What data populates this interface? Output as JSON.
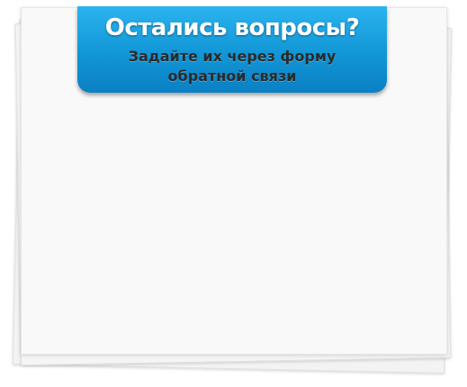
{
  "banner": {
    "title": "Остались вопросы?",
    "subtitle_line1": "Задайте их через форму",
    "subtitle_line2": "обратной связи"
  },
  "colors": {
    "banner_top": "#2ab4ee",
    "banner_bottom": "#0a80c4",
    "paper": "#f9f9f9",
    "title_text": "#ffffff",
    "subtitle_text": "#2a2a2a"
  }
}
